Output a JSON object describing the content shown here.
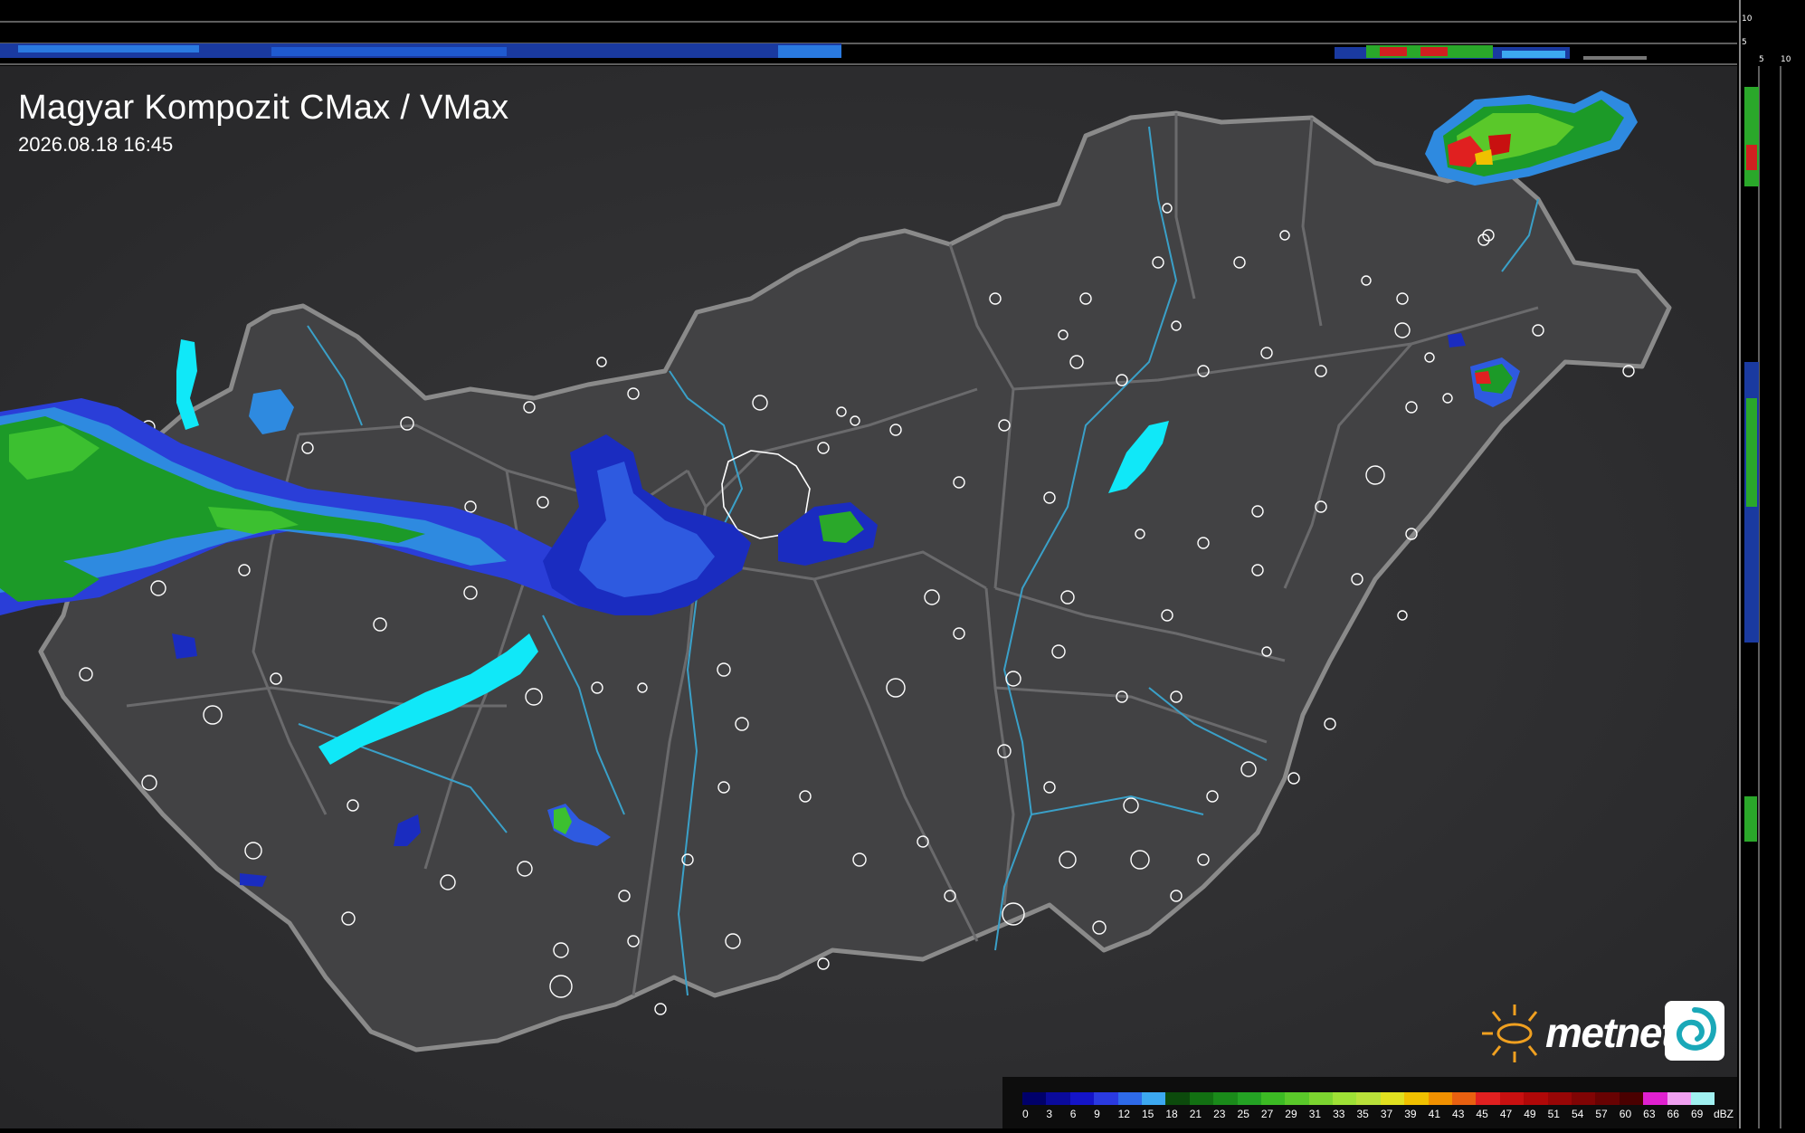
{
  "title": "Magyar Kompozit CMax / VMax",
  "timestamp": "2026.08.18 16:45",
  "brand": "metnet",
  "strip_scale": {
    "top": [
      "10",
      "5"
    ],
    "side": [
      "5",
      "10"
    ]
  },
  "legend": {
    "unit": "dBZ",
    "ticks": [
      "0",
      "3",
      "6",
      "9",
      "12",
      "15",
      "18",
      "21",
      "23",
      "25",
      "27",
      "29",
      "31",
      "33",
      "35",
      "37",
      "39",
      "41",
      "43",
      "45",
      "47",
      "49",
      "51",
      "54",
      "57",
      "60",
      "63",
      "66",
      "69"
    ],
    "colors": [
      "#00006a",
      "#0a0a9c",
      "#1414c8",
      "#2a3ae0",
      "#2e6ae8",
      "#3ca8f0",
      "#0c4a0c",
      "#127012",
      "#1a8a1a",
      "#24a224",
      "#3cba24",
      "#5ac82a",
      "#7cd430",
      "#9ee036",
      "#b8e03a",
      "#e0e020",
      "#f0c000",
      "#f09000",
      "#e86010",
      "#e02020",
      "#c81010",
      "#b00808",
      "#980606",
      "#800404",
      "#680202",
      "#4a0000",
      "#e020d0",
      "#f0a0f0",
      "#a0f0f0"
    ]
  },
  "icons": [
    "metnet-sun-logo-icon",
    "metnet-swirl-logo-icon"
  ]
}
